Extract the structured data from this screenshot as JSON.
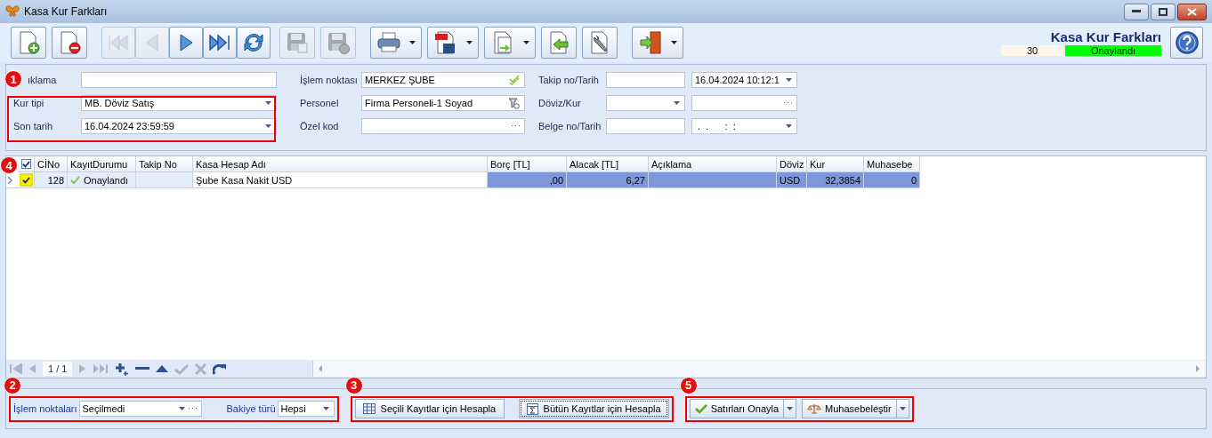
{
  "window": {
    "title": "Kasa Kur Farkları"
  },
  "toolbar_groups": [
    [
      {
        "kind": "new",
        "disabled": false
      },
      {
        "kind": "delete",
        "disabled": false
      }
    ],
    [
      {
        "kind": "first",
        "disabled": true
      },
      {
        "kind": "prev",
        "disabled": true
      },
      {
        "kind": "next",
        "disabled": false
      },
      {
        "kind": "last",
        "disabled": false
      },
      {
        "kind": "refresh",
        "disabled": false
      }
    ],
    [
      {
        "kind": "save",
        "disabled": true
      },
      {
        "kind": "cancel",
        "disabled": true
      }
    ],
    [
      {
        "kind": "print",
        "disabled": false,
        "dropdown": true
      },
      {
        "kind": "pdf",
        "disabled": false,
        "dropdown": true
      },
      {
        "kind": "copy",
        "disabled": false,
        "dropdown": true
      },
      {
        "kind": "import",
        "disabled": false
      },
      {
        "kind": "tools",
        "disabled": false
      }
    ],
    [
      {
        "kind": "exit",
        "disabled": false,
        "dropdown": true
      }
    ]
  ],
  "header": {
    "title": "Kasa Kur Farkları",
    "number": "30",
    "status": "Onaylandı"
  },
  "form_columns": [
    [
      {
        "label": "ıklama",
        "fields": [
          {
            "kind": "text"
          }
        ]
      },
      {
        "label": "Kur tipi",
        "fields": [
          {
            "kind": "combo",
            "value": "MB. Döviz Satış"
          }
        ]
      },
      {
        "label": "Son tarih",
        "fields": [
          {
            "kind": "combo",
            "value": "16.04.2024 23:59:59"
          }
        ]
      }
    ],
    [
      {
        "label": "İşlem noktası",
        "fields": [
          {
            "kind": "check",
            "value": "MERKEZ ŞUBE"
          }
        ]
      },
      {
        "label": "Personel",
        "fields": [
          {
            "kind": "lookup",
            "value": "Firma Personeli-1 Soyad"
          }
        ]
      },
      {
        "label": "Özel kod",
        "fields": [
          {
            "kind": "ellipsis"
          }
        ]
      }
    ],
    [
      {
        "label": "Takip no/Tarih",
        "fields": [
          {
            "kind": "text"
          },
          {
            "kind": "combo",
            "value": "16.04.2024 10:12:1"
          }
        ]
      },
      {
        "label": "Döviz/Kur",
        "fields": [
          {
            "kind": "combo"
          },
          {
            "kind": "ellipsis"
          }
        ]
      },
      {
        "label": "Belge no/Tarih",
        "fields": [
          {
            "kind": "text"
          },
          {
            "kind": "combo",
            "value": " .  .      :  :"
          }
        ]
      }
    ]
  ],
  "grid": {
    "all_checked": true,
    "columns": [
      "CİNo",
      "KayıtDurumu",
      "Takip No",
      "Kasa Hesap Adı",
      "Borç [TL]",
      "Alacak [TL]",
      "Açıklama",
      "Döviz",
      "Kur",
      "Muhasebe"
    ],
    "rows": [
      {
        "checked": true,
        "selected": true,
        "cino": "128",
        "status": "Onaylandı",
        "account": "Şube Kasa Nakit USD",
        "debit": ",00",
        "credit": "6,27",
        "currency": "USD",
        "rate": "32,3854",
        "accounting": "0"
      }
    ],
    "page": "1 / 1"
  },
  "filters": {
    "points_label": "İşlem noktaları",
    "points_value": "Seçilmedi",
    "balance_label": "Bakiye türü",
    "balance_value": "Hepsi"
  },
  "calc_buttons": [
    {
      "label": "Seçili Kayıtlar için Hesapla",
      "focused": false
    },
    {
      "label": "Bütün Kayıtlar için Hesapla",
      "focused": true
    }
  ],
  "action_buttons": [
    {
      "kind": "approve",
      "label": "Satırları Onayla"
    },
    {
      "kind": "post",
      "label": "Muhasebeleştir"
    }
  ],
  "callouts": [
    {
      "number": "1"
    },
    {
      "number": "4"
    },
    {
      "number": "2"
    },
    {
      "number": "3"
    },
    {
      "number": "5"
    }
  ]
}
